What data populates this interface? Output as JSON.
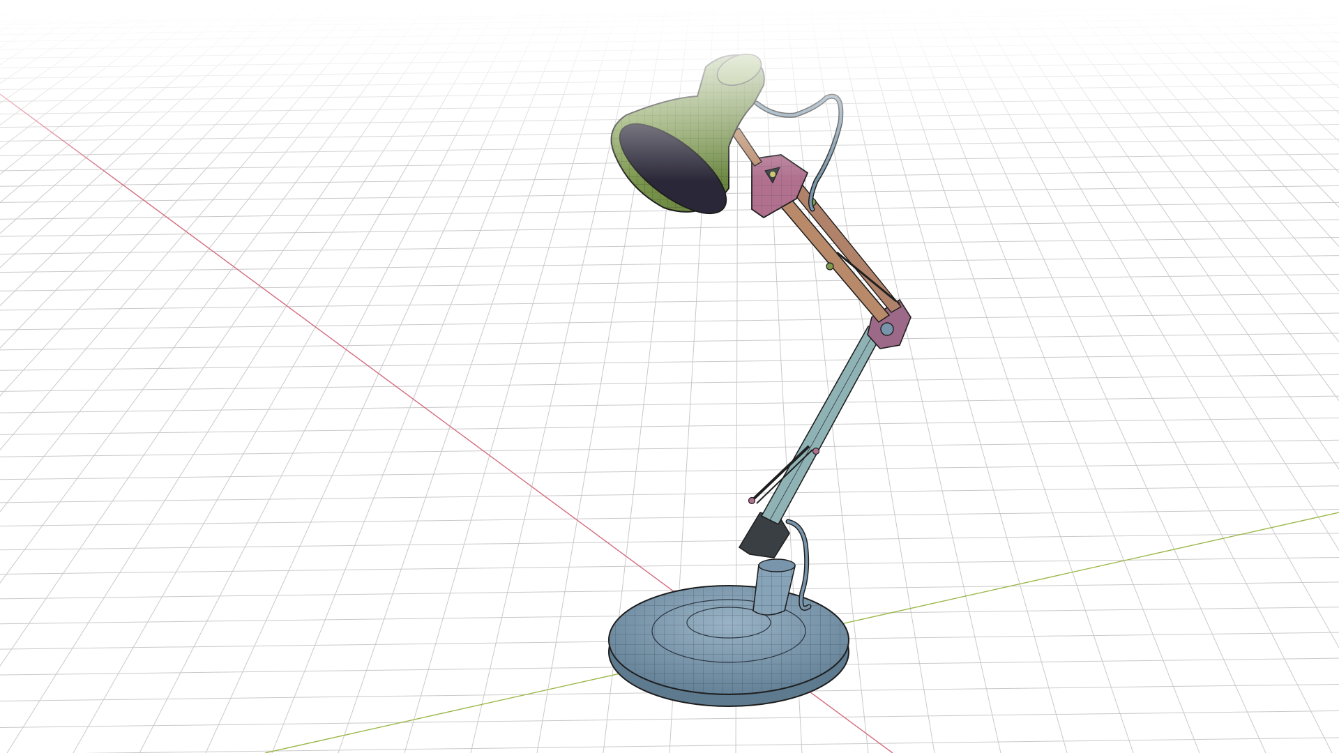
{
  "viewport": {
    "background": "#ffffff",
    "grid_color": "#c9c9c9",
    "x_axis_color": "#d46a7e",
    "y_axis_color": "#9bb84a"
  },
  "model": {
    "shade_color": "#7f9a4f",
    "shade_interior_color": "#2a2838",
    "joint_color": "#b0708e",
    "upper_arm_color": "#b98a6a",
    "lower_arm_color": "#8fb3b5",
    "base_color": "#7f9bb0",
    "wire_color": "#1e1e1e"
  }
}
